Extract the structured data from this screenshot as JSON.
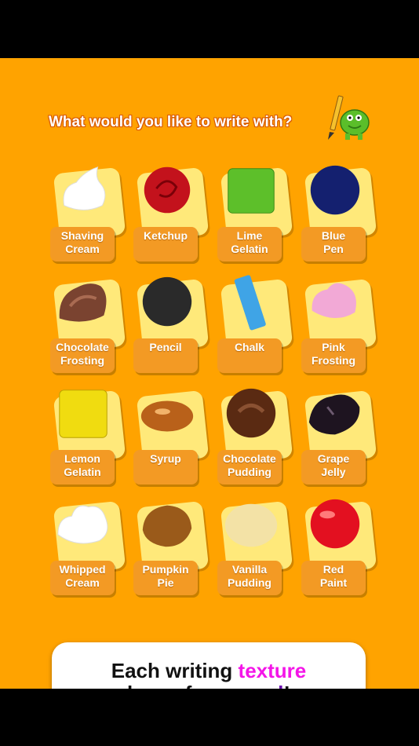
{
  "header": {
    "prompt": "What would you like to write with?"
  },
  "textures": [
    {
      "label": "Shaving Cream",
      "icon": "shaving-cream-icon",
      "color": "#FFFFFF"
    },
    {
      "label": "Ketchup",
      "icon": "ketchup-icon",
      "color": "#C3121C"
    },
    {
      "label": "Lime Gelatin",
      "icon": "lime-gelatin-icon",
      "color": "#5DBF2A"
    },
    {
      "label": "Blue Pen",
      "icon": "blue-pen-icon",
      "color": "#14206F"
    },
    {
      "label": "Chocolate Frosting",
      "icon": "chocolate-frosting-icon",
      "color": "#7A4330"
    },
    {
      "label": "Pencil",
      "icon": "pencil-icon",
      "color": "#2A2A2A"
    },
    {
      "label": "Chalk",
      "icon": "chalk-icon",
      "color": "#3FA4E6"
    },
    {
      "label": "Pink Frosting",
      "icon": "pink-frosting-icon",
      "color": "#F2A9D6"
    },
    {
      "label": "Lemon Gelatin",
      "icon": "lemon-gelatin-icon",
      "color": "#F0DC10"
    },
    {
      "label": "Syrup",
      "icon": "syrup-icon",
      "color": "#B9611A"
    },
    {
      "label": "Chocolate Pudding",
      "icon": "chocolate-pudding-icon",
      "color": "#5A2A12"
    },
    {
      "label": "Grape Jelly",
      "icon": "grape-jelly-icon",
      "color": "#1E1420"
    },
    {
      "label": "Whipped Cream",
      "icon": "whipped-cream-icon",
      "color": "#FFFFFF"
    },
    {
      "label": "Pumpkin Pie",
      "icon": "pumpkin-pie-icon",
      "color": "#9A5A1A"
    },
    {
      "label": "Vanilla Pudding",
      "icon": "vanilla-pudding-icon",
      "color": "#F3E2A6"
    },
    {
      "label": "Red Paint",
      "icon": "red-paint-icon",
      "color": "#E31020"
    }
  ],
  "banner": {
    "line1_a": "Each writing ",
    "line1_b": "texture",
    "line2_a": "has a fun ",
    "line2_b": "sound",
    "line2_c": "!"
  },
  "colors": {
    "background": "#FFA300",
    "card": "#FFE97A",
    "label": "#F39A24",
    "accent_pink": "#F415E8",
    "accent_purple": "#6A0DAD"
  }
}
